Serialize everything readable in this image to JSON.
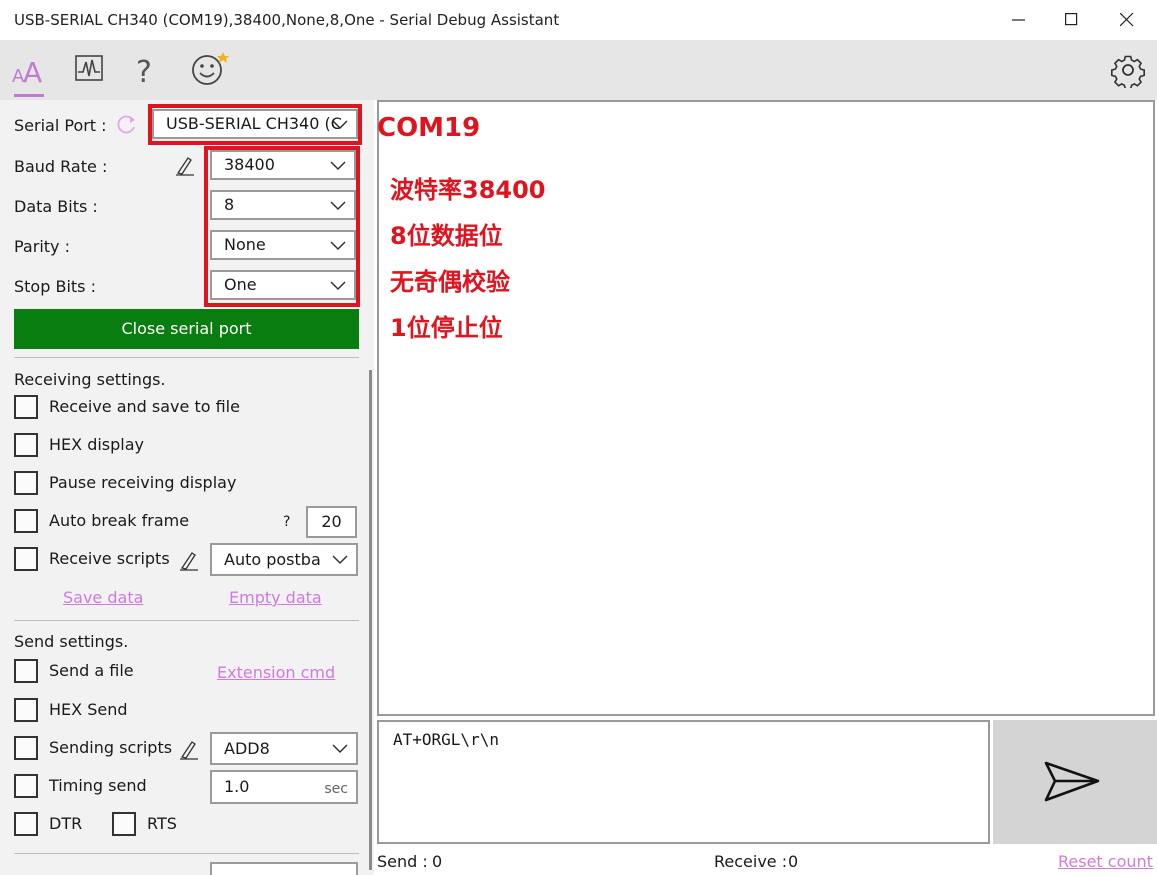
{
  "window": {
    "title": "USB-SERIAL CH340 (COM19),38400,None,8,One - Serial Debug Assistant"
  },
  "toolbar": {
    "icons": [
      "font-icon",
      "chart-icon",
      "help-icon",
      "smiley-icon",
      "settings-icon"
    ],
    "help_glyph": "?",
    "accent_color": "#c17ad6"
  },
  "serial": {
    "port_label": "Serial Port :",
    "port_value": "USB-SERIAL CH340 (C",
    "baud_label": "Baud Rate :",
    "baud_value": "38400",
    "databits_label": "Data Bits :",
    "databits_value": "8",
    "parity_label": "Parity :",
    "parity_value": "None",
    "stopbits_label": "Stop Bits :",
    "stopbits_value": "One",
    "close_button": "Close serial port",
    "close_button_color": "#0a7d10"
  },
  "receiving": {
    "heading": "Receiving settings.",
    "save_to_file": "Receive and save to file",
    "hex_display": "HEX display",
    "pause_display": "Pause receiving display",
    "auto_break": "Auto break frame",
    "auto_break_help": "?",
    "auto_break_value": "20",
    "receive_scripts": "Receive scripts",
    "receive_scripts_value": "Auto postba",
    "save_data": "Save data",
    "empty_data": "Empty data"
  },
  "sending": {
    "heading": "Send settings.",
    "send_file": "Send a file",
    "extension_cmd": "Extension cmd",
    "hex_send": "HEX Send",
    "sending_scripts": "Sending scripts",
    "sending_scripts_value": "ADD8",
    "timing_send": "Timing send",
    "timing_value": "1.0",
    "timing_unit": "sec",
    "dtr": "DTR",
    "rts": "RTS"
  },
  "annotations": {
    "com": "COM19",
    "line1": "波特率38400",
    "line2": "8位数据位",
    "line3": "无奇偶校验",
    "line4": "1位停止位",
    "color": "#e0141e"
  },
  "send_area": {
    "text": "AT+ORGL\\r\\n"
  },
  "status": {
    "send_label": "Send :",
    "send_value": "0",
    "receive_label": "Receive :",
    "receive_value": "0",
    "reset_count": "Reset count"
  }
}
